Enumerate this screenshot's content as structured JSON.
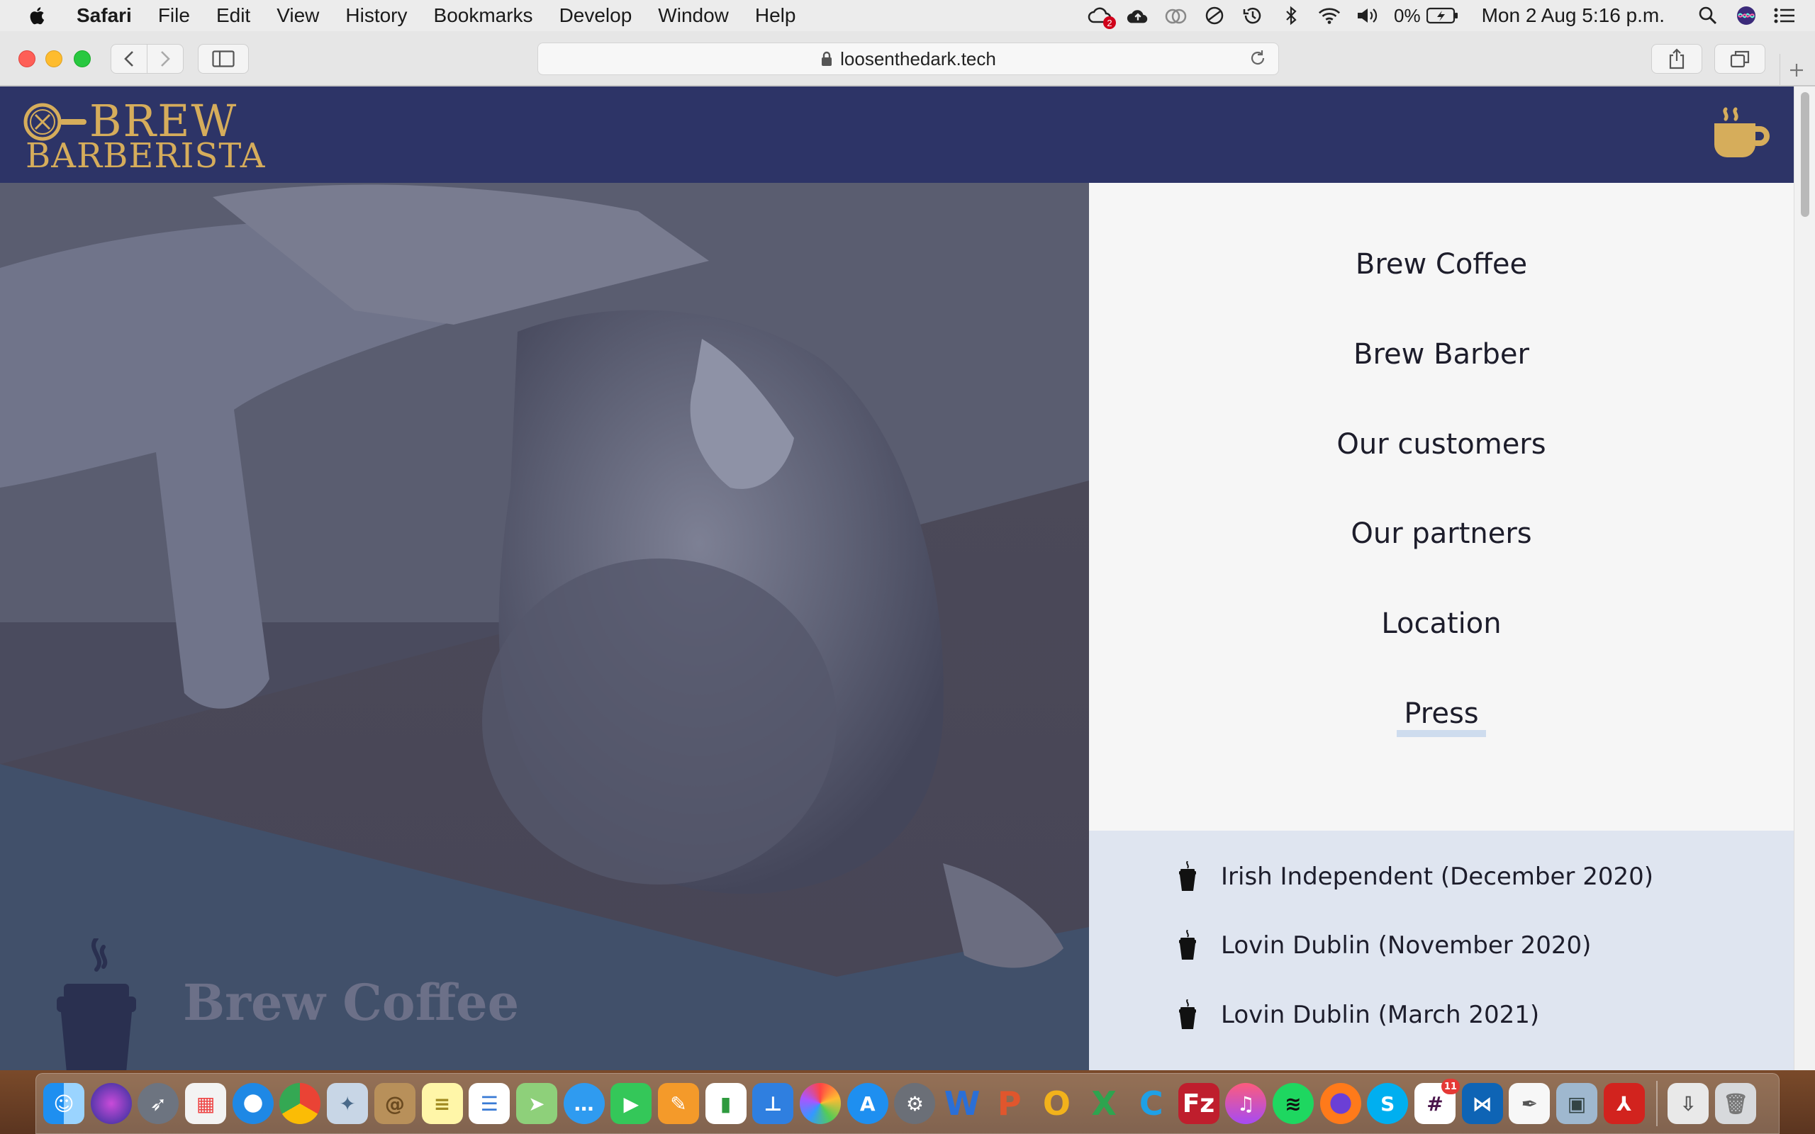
{
  "menubar": {
    "app_name": "Safari",
    "menus": [
      "File",
      "Edit",
      "View",
      "History",
      "Bookmarks",
      "Develop",
      "Window",
      "Help"
    ],
    "battery": "0%",
    "clock": "Mon 2 Aug  5:16 p.m.",
    "cloud_badge": "2"
  },
  "browser": {
    "url": "loosenthedark.tech"
  },
  "site": {
    "logo_top": "BREW",
    "logo_bottom": "BARBERISTA",
    "nav": [
      "Brew Coffee",
      "Brew Barber",
      "Our customers",
      "Our partners",
      "Location",
      "Press"
    ],
    "active_nav": "Press",
    "press": [
      "Irish Independent (December 2020)",
      "Lovin Dublin (November 2020)",
      "Lovin Dublin (March 2021)"
    ],
    "hero_caption": "Brew Coffee",
    "colors": {
      "header": "#2d3467",
      "gold": "#d6ad5b",
      "press_bg": "#dfe5f0"
    }
  },
  "dock": {
    "icons": [
      "finder-icon",
      "siri-icon",
      "launchpad-icon",
      "apps-grid-icon",
      "safari-icon",
      "chrome-icon",
      "preview-icon",
      "contacts-icon",
      "notes-icon",
      "reminders-icon",
      "maps-icon",
      "messages-icon",
      "facetime-icon",
      "pages-icon",
      "numbers-icon",
      "keynote-icon",
      "photos-icon",
      "app-store-icon",
      "system-preferences-icon",
      "word-icon",
      "powerpoint-icon",
      "outlook-icon",
      "excel-icon",
      "c-app-icon",
      "filezilla-icon",
      "music-icon",
      "spotify-icon",
      "firefox-icon",
      "skype-icon",
      "slack-icon",
      "vscode-icon",
      "textedit-icon",
      "image-capture-icon",
      "acrobat-icon",
      "downloads-icon",
      "trash-icon"
    ],
    "slack_badge": "11"
  }
}
